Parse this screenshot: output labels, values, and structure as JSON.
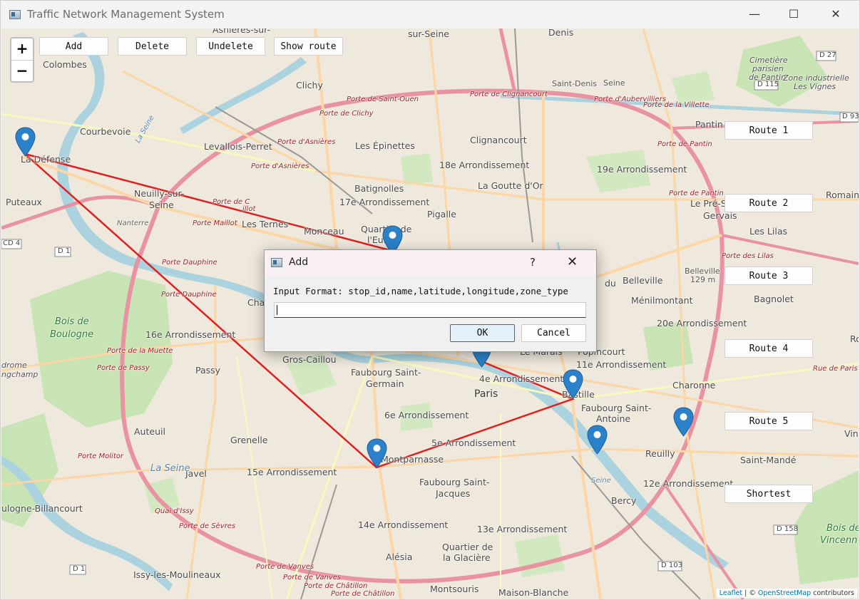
{
  "window": {
    "title": "Traffic Network Management System",
    "controls": {
      "minimize": "—",
      "maximize": "☐",
      "close": "✕"
    }
  },
  "toolbar": {
    "zoom_in": "+",
    "zoom_out": "−",
    "add": "Add",
    "delete": "Delete",
    "undelete": "Undelete",
    "show_route": "Show route"
  },
  "route_buttons": [
    "Route 1",
    "Route 2",
    "Route 3",
    "Route 4",
    "Route 5",
    "Shortest"
  ],
  "map": {
    "place_labels": [
      "Asnières-sur-",
      "sur-Seine",
      "Denis",
      "Colombes",
      "Clichy",
      "Courbevoie",
      "Levallois-Perret",
      "La Défense",
      "Les Épinettes",
      "Clignancourt",
      "18e Arrondissement",
      "La Goutte d'Or",
      "19e Arrondissement",
      "Pantin",
      "Romain",
      "Le Pré-S",
      "Gervais",
      "Les Lilas",
      "Batignolles",
      "17e Arrondissement",
      "Neuilly-sur-",
      "Seine",
      "Puteaux",
      "Pigalle",
      "Les Ternes",
      "Monceau",
      "Quartier de",
      "l'Euro",
      "Bagnolet",
      "Belleville",
      "Ménilmontant",
      "20e Arrondissement",
      "du",
      "Cha",
      "16e Arrondissement",
      "Bois de",
      "Boulogne",
      "Gros-Caillou",
      "Le Marais",
      "Popincourt",
      "11e Arrondissement",
      "Faubourg Saint-",
      "Germain",
      "4e Arrondissement",
      "Paris",
      "Bastille",
      "Charonne",
      "Passy",
      "Faubourg Saint-",
      "Antoine",
      "6e Arrondissement",
      "Auteuil",
      "Grenelle",
      "5e Arrondissement",
      "Reuilly",
      "Saint-Mandé",
      "Montparnasse",
      "15e Arrondissement",
      "Javel",
      "Faubourg Saint-",
      "Jacques",
      "12e Arrondissement",
      "Bercy",
      "ulogne-Billancourt",
      "14e Arrondissement",
      "13e Arrondissement",
      "Quartier de",
      "la Glacière",
      "Alésia",
      "Issy-les-Moulineaux",
      "Montsouris",
      "Maison-Blanche",
      "Bois de",
      "Vincenn",
      "Cimetière",
      "parisien",
      "de Pantin",
      "Zone industrielle",
      "Les Vignes",
      "Saint-Denis",
      "Seine",
      "Belleville",
      "129 m",
      "drome",
      "ngchamp",
      "Vin",
      "Ro"
    ],
    "road_labels": [
      "Porte de Saint-Ouen",
      "Porte de Clignancourt",
      "Porte d'Aubervilliers",
      "Porte de la Villette",
      "Porte de Clichy",
      "Porte d'Asnières",
      "Porte d'Asnières",
      "Porte de Pantin",
      "Porte de Pantin",
      "Porte de C",
      "Porte Maillot",
      "Porte des Lilas",
      "Porte Dauphine",
      "Porte Dauphine",
      "Porte de la Muette",
      "Porte de Passy",
      "Porte Molitor",
      "Quai d'Issy",
      "Porte de Sèvres",
      "Porte de Vanves",
      "Porte de Vanves",
      "Porte de Châtillon",
      "Porte de Châtillon",
      "Rue de Paris",
      "illot",
      "Nanterre"
    ],
    "road_shields": [
      "D 27",
      "D 115",
      "D 93",
      "CD 4",
      "D 1",
      "D 1",
      "D 158",
      "D 103"
    ],
    "river_labels": [
      "La Seine",
      "La Seine",
      "Seine"
    ],
    "stops": [
      "La Défense",
      "Quartier de l'Europe",
      "Le Marais",
      "Bastille",
      "Montparnasse",
      "Bercy",
      "Charonne"
    ],
    "attribution": {
      "leaflet": "Leaflet",
      "separator": "|",
      "copyright": "©",
      "osm": "OpenStreetMap",
      "contributors": "contributors"
    }
  },
  "dialog": {
    "title": "Add",
    "help": "?",
    "close": "✕",
    "prompt": "Input Format: stop_id,name,latitude,longitude,zone_type",
    "input_value": "",
    "ok": "OK",
    "cancel": "Cancel"
  },
  "colors": {
    "route_line": "#e02020",
    "marker": "#2b82cb",
    "park": "#c8e4b4",
    "water": "#aad3df",
    "motorway": "#e892a2",
    "primary": "#fcd6a4"
  }
}
